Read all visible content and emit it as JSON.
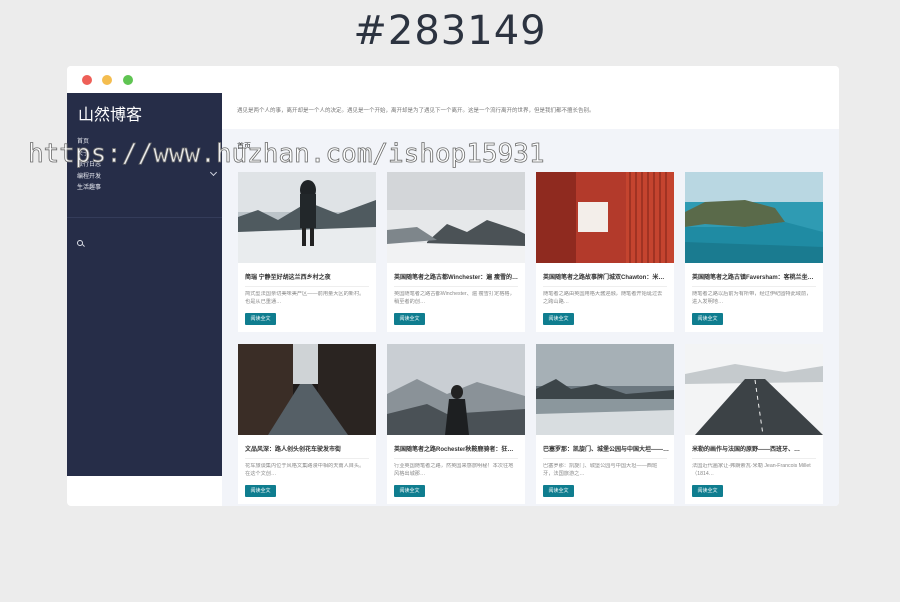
{
  "banner": {
    "title": "#283149"
  },
  "sidebar": {
    "site_title": "山然博客",
    "nav": [
      "首页",
      "关于",
      "旅行日志",
      "编程开发",
      "生活趣事"
    ]
  },
  "intro": "遇见是两个人的事，离开却是一个人的决定。遇见是一个开始，离开却是为了遇见下一个离开。这是一个流行离开的世界，但是我们都不擅长告别。",
  "breadcrumb": "首页",
  "cards": [
    {
      "title": "简瑞 宁静至好胡这兰西乡村之夜",
      "excerpt": "简式型法国亲切美味美产区——前用量大区的新村。也是从已重通…",
      "button": "阅读全文"
    },
    {
      "title": "英国随笔者之路古都Winchester：遍 瘦雪的…",
      "excerpt": "英国随笔者之路古都Winchester、遍 瘦雪打定格格，稍至者的创…",
      "button": "阅读全文"
    },
    {
      "title": "英国随笔者之路故事牌门城双Chawton：米…",
      "excerpt": "随笔者之路由英国用格大酱迎融，随笔者开始诞过去之跨山路…",
      "button": "阅读全文"
    },
    {
      "title": "英国随笔者之路古镇Faversham：客桃兰坐…",
      "excerpt": "随笔者之路以后前为有所带，经过伊纪圆特此域前，进入发明地…",
      "button": "阅读全文"
    },
    {
      "title": "文品风深：路人创头创花车驶发市街",
      "excerpt": "花车旅谈集内位于风格文集路漫中相的天南人目头。在这个文创…",
      "button": "阅读全文"
    },
    {
      "title": "英国随笔者之路Rochester秋鞍鹿骑者：狂…",
      "excerpt": "行业英国随笔者之路，然英国来感旅明秘！本次往地风格出城那…",
      "button": "阅读全文"
    },
    {
      "title": "巴塞罗那：凯旋门、城堡公园与中国大坦——…",
      "excerpt": "巴塞罗那：凯旋门、城堡公园与中国大坦——西班牙，法国旅游之…",
      "button": "阅读全文"
    },
    {
      "title": "米勒的画作与法国的原野——西班牙、…",
      "excerpt": "法国近代画家让-弗朗索瓦·米勒 Jean-Francois Millet （1814…",
      "button": "阅读全文"
    }
  ],
  "watermark": "https://www.huzhan.com/ishop15931",
  "colors": {
    "sidebar": "#262d48",
    "accent": "#0f7d8f",
    "background": "#ececec"
  }
}
